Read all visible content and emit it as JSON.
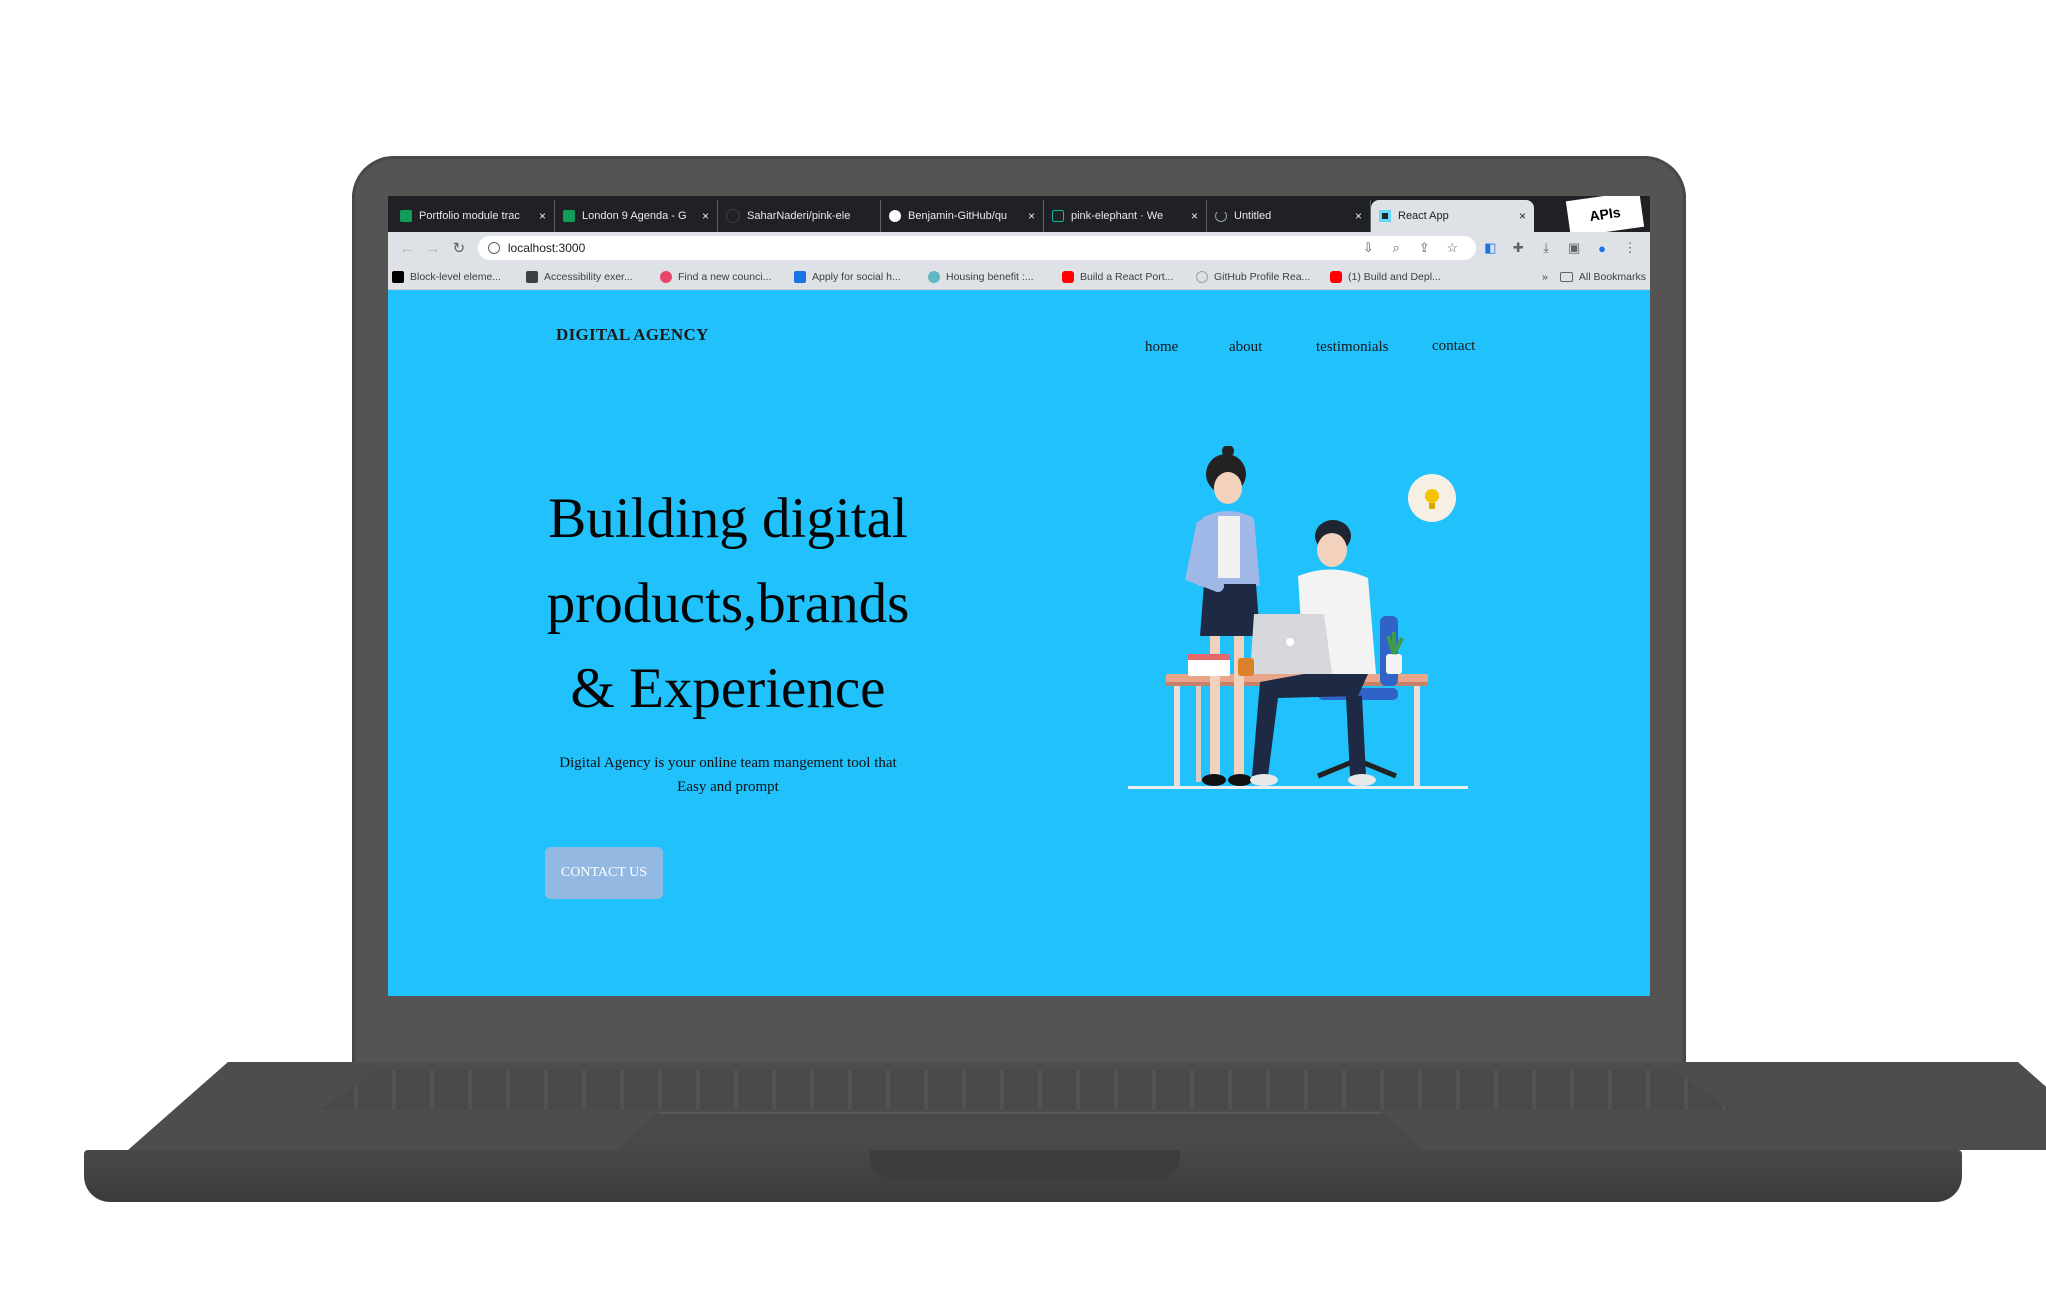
{
  "browser": {
    "tabs": [
      {
        "title": "Portfolio module trac",
        "favicon_color": "#0f9d58",
        "active": false
      },
      {
        "title": "London 9 Agenda - G",
        "favicon_color": "#0f9d58",
        "active": false
      },
      {
        "title": "SaharNaderi/pink-ele",
        "favicon_color": "#202124",
        "active": false
      },
      {
        "title": "Benjamin-GitHub/qu",
        "favicon_color": "#ffffff",
        "active": false
      },
      {
        "title": "pink-elephant · We",
        "favicon_color": "#0fb5a3",
        "active": false
      },
      {
        "title": "Untitled",
        "favicon_color": "#9aa0a6",
        "active": false
      },
      {
        "title": "React App",
        "favicon_color": "#61dafb",
        "active": true
      }
    ],
    "tab_close": "×",
    "badge_text": "APIs",
    "nav": {
      "back": "←",
      "forward": "→",
      "reload": "↻"
    },
    "url": "localhost:3000",
    "bookmarks": [
      {
        "label": "Block-level eleme...",
        "color": "#000000"
      },
      {
        "label": "Accessibility exer...",
        "color": "#3c4043"
      },
      {
        "label": "Find a new counci...",
        "color": "#e8456b"
      },
      {
        "label": "Apply for social h...",
        "color": "#1a73e8"
      },
      {
        "label": "Housing benefit :...",
        "color": "#5fb7c4"
      },
      {
        "label": "Build a React Port...",
        "color": "#ff0000"
      },
      {
        "label": "GitHub Profile Rea...",
        "color": "#9aa0a6"
      },
      {
        "label": "(1) Build and Depl...",
        "color": "#ff0000"
      }
    ],
    "bookmarks_more": "»",
    "all_bookmarks": "All Bookmarks"
  },
  "site": {
    "logo": "DIGITAL AGENCY",
    "nav": {
      "home": "home",
      "about": "about",
      "testimonials": "testimonials",
      "contact": "contact"
    },
    "hero": {
      "title_line1": "Building digital",
      "title_line2": "products,brands",
      "title_line3": "& Experience",
      "subtitle_line1": "Digital Agency is your online team mangement tool that",
      "subtitle_line2": "Easy and prompt",
      "cta": "CONTACT US"
    },
    "colors": {
      "background": "#21c1fb",
      "cta": "#93b9e3"
    }
  }
}
